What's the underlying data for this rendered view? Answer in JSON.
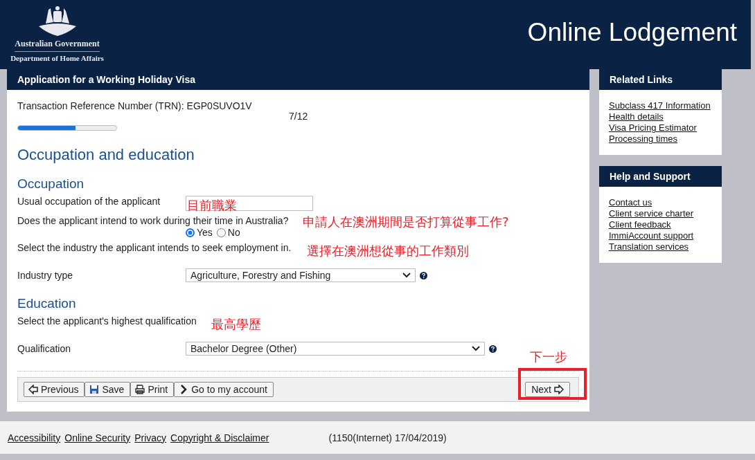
{
  "header": {
    "agency_line_1": "Australian Government",
    "agency_line_2": "Department of Home Affairs",
    "title": "Online Lodgement"
  },
  "form": {
    "title": "Application for a Working Holiday Visa",
    "trn": "Transaction Reference Number (TRN): EGP0SUVO1V",
    "step": "7/12",
    "progress": {
      "level": 0.583
    },
    "heading": "Occupation and education",
    "sections": [
      {
        "heading": "Occupation",
        "rows": [
          {
            "kind": "text",
            "label": "Usual occupation of the applicant"
          },
          {
            "kind": "radio",
            "label": "Does the applicant intend to work during their time in Australia?",
            "options": [
              {
                "label": "Yes",
                "selected": true
              },
              {
                "label": "No",
                "selected": false
              }
            ]
          },
          {
            "kind": "note",
            "label": "Select the industry the applicant intends to seek employment in."
          },
          {
            "kind": "select",
            "label": "Industry type",
            "value": "Agriculture, Forestry and Fishing"
          }
        ]
      },
      {
        "heading": "Education",
        "rows": [
          {
            "kind": "note",
            "label": "Select the applicant's highest qualification"
          },
          {
            "kind": "select",
            "label": "Qualification",
            "value": "Bachelor Degree (Other)"
          }
        ]
      }
    ],
    "buttons": [
      {
        "label": "Previous"
      },
      {
        "label": "Save"
      },
      {
        "label": "Print"
      },
      {
        "label": "Go to my account"
      }
    ],
    "next_button": {
      "label": "Next"
    }
  },
  "sidebar": [
    {
      "title": "Related Links",
      "links": [
        "Subclass 417 Information",
        "Health details",
        "Visa Pricing Estimator",
        "Processing times"
      ]
    },
    {
      "title": "Help and Support",
      "links": [
        "Contact us",
        "Client service charter",
        "Client feedback",
        "ImmiAccount support",
        "Translation services"
      ]
    }
  ],
  "annotations": [
    "目前職業",
    "申請人在澳洲期間是否打算從事工作?",
    "選擇在澳洲想從事的工作類別",
    "最高學歷",
    "下一步"
  ],
  "footer": {
    "links": [
      "Accessibility",
      "Online Security",
      "Privacy",
      "Copyright & Disclaimer"
    ],
    "version": "(1150(Internet) 17/04/2019)"
  }
}
